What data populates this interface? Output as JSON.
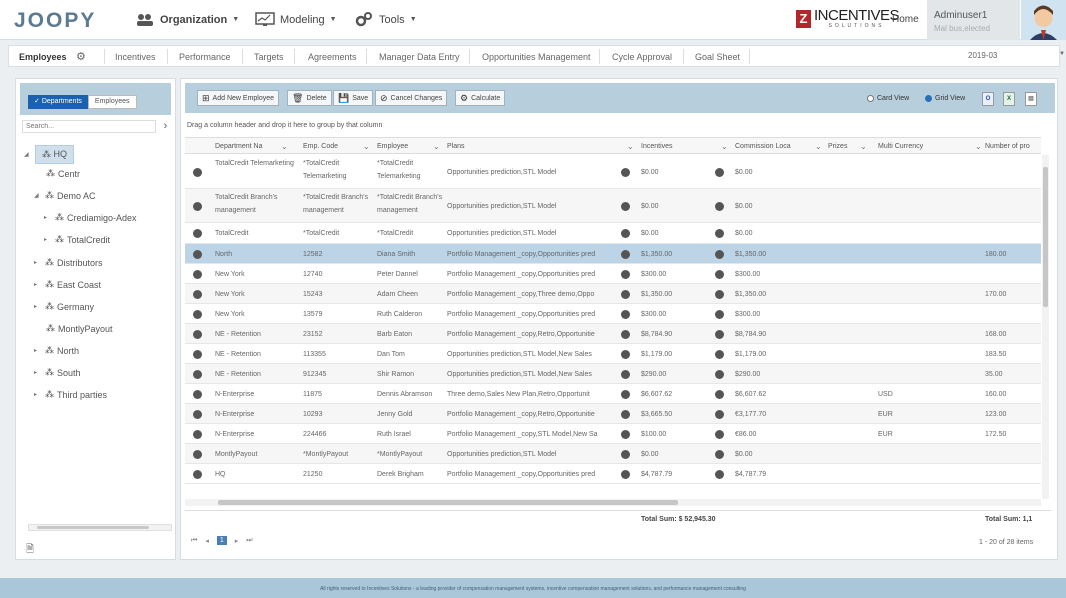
{
  "app": {
    "logo": "JOOPY"
  },
  "nav": {
    "organization": "Organization",
    "modeling": "Modeling",
    "tools": "Tools",
    "brand_main": "INCENTIVES",
    "brand_sub": "SOLUTIONS",
    "home": "Home",
    "user_name": "Adminuser1",
    "user_sub": "Mal bus,elected"
  },
  "tabs": [
    "Employees",
    "Incentives",
    "Performance",
    "Targets",
    "Agreements",
    "Manager Data Entry",
    "Opportunities Management",
    "Cycle Approval",
    "Goal Sheet"
  ],
  "period": "2019-03",
  "left": {
    "toggle_on": "Departments",
    "toggle_off": "Employees",
    "search_placeholder": "Search...",
    "tree": [
      {
        "label": "HQ"
      },
      {
        "label": "Centr"
      },
      {
        "label": "Demo AC"
      },
      {
        "label": "Crediamigo-Adex"
      },
      {
        "label": "TotalCredit"
      },
      {
        "label": "Distributors"
      },
      {
        "label": "East Coast"
      },
      {
        "label": "Germany"
      },
      {
        "label": "MontlyPayout"
      },
      {
        "label": "North"
      },
      {
        "label": "South"
      },
      {
        "label": "Third parties"
      }
    ]
  },
  "toolbar": {
    "add": "Add New Employee",
    "delete": "Delete",
    "save": "Save",
    "cancel": "Cancel Changes",
    "calculate": "Calculate",
    "card_view": "Card View",
    "grid_view": "Grid View"
  },
  "grid": {
    "group_hint": "Drag a column header and drop it here to group by that column",
    "columns": [
      "Department Na",
      "Emp. Code",
      "Employee",
      "Plans",
      "Incentives",
      "Commission Loca",
      "Prizes",
      "Multi Currency",
      "Number of pro"
    ],
    "rows": [
      {
        "dept": "TotalCredit Telemarketing",
        "code": "*TotalCredit Telemarketing",
        "emp": "*TotalCredit Telemarketing",
        "plans": "Opportunities prediction,STL Model",
        "inc": "$0.00",
        "comm": "$0.00",
        "cur": "",
        "num": ""
      },
      {
        "dept": "TotalCredit Branch's management",
        "code": "*TotalCredit Branch's management",
        "emp": "*TotalCredit Branch's management",
        "plans": "Opportunities prediction,STL Model",
        "inc": "$0.00",
        "comm": "$0.00",
        "cur": "",
        "num": ""
      },
      {
        "dept": "TotalCredit",
        "code": "*TotalCredit",
        "emp": "*TotalCredit",
        "plans": "Opportunities prediction,STL Model",
        "inc": "$0.00",
        "comm": "$0.00",
        "cur": "",
        "num": ""
      },
      {
        "dept": "North",
        "code": "12582",
        "emp": "Diana Smith",
        "plans": "Portfolio Management _copy,Opportunities pred",
        "inc": "$1,350.00",
        "comm": "$1,350.00",
        "cur": "",
        "num": "180.00"
      },
      {
        "dept": "New York",
        "code": "12740",
        "emp": "Peter Dannel",
        "plans": "Portfolio Management _copy,Opportunities pred",
        "inc": "$300.00",
        "comm": "$300.00",
        "cur": "",
        "num": ""
      },
      {
        "dept": "New York",
        "code": "15243",
        "emp": "Adam Cheen",
        "plans": "Portfolio Management _copy,Three demo,Oppo",
        "inc": "$1,350.00",
        "comm": "$1,350.00",
        "cur": "",
        "num": "170.00"
      },
      {
        "dept": "New York",
        "code": "13579",
        "emp": "Ruth Calderon",
        "plans": "Portfolio Management _copy,Opportunities pred",
        "inc": "$300.00",
        "comm": "$300.00",
        "cur": "",
        "num": ""
      },
      {
        "dept": "NE - Retention",
        "code": "23152",
        "emp": "Barb Eaton",
        "plans": "Portfolio Management _copy,Retro,Opportunitie",
        "inc": "$8,784.90",
        "comm": "$8,784.90",
        "cur": "",
        "num": "168.00"
      },
      {
        "dept": "NE - Retention",
        "code": "113355",
        "emp": "Dan Tom",
        "plans": "Opportunities prediction,STL Model,New Sales",
        "inc": "$1,179.00",
        "comm": "$1,179.00",
        "cur": "",
        "num": "183.50"
      },
      {
        "dept": "NE - Retention",
        "code": "912345",
        "emp": "Shir Ramon",
        "plans": "Opportunities prediction,STL Model,New Sales",
        "inc": "$290.00",
        "comm": "$290.00",
        "cur": "",
        "num": "35.00"
      },
      {
        "dept": "N-Enterprise",
        "code": "11875",
        "emp": "Dennis Abramson",
        "plans": "Three demo,Sales New Plan,Retro,Opportunit",
        "inc": "$6,607.62",
        "comm": "$6,607.62",
        "cur": "USD",
        "num": "160.00"
      },
      {
        "dept": "N-Enterprise",
        "code": "10293",
        "emp": "Jenny Gold",
        "plans": "Portfolio Management _copy,Retro,Opportunitie",
        "inc": "$3,665.50",
        "comm": "€3,177.70",
        "cur": "EUR",
        "num": "123.00"
      },
      {
        "dept": "N-Enterprise",
        "code": "224466",
        "emp": "Ruth Israel",
        "plans": "Portfolio Management _copy,STL Model,New Sa",
        "inc": "$100.00",
        "comm": "€86.00",
        "cur": "EUR",
        "num": "172.50"
      },
      {
        "dept": "MontlyPayout",
        "code": "*MontlyPayout",
        "emp": "*MontlyPayout",
        "plans": "Opportunities prediction,STL Model",
        "inc": "$0.00",
        "comm": "$0.00",
        "cur": "",
        "num": ""
      },
      {
        "dept": "HQ",
        "code": "21250",
        "emp": "Derek Brigham",
        "plans": "Portfolio Management _copy,Opportunities pred",
        "inc": "$4,787.79",
        "comm": "$4,787.79",
        "cur": "",
        "num": ""
      }
    ],
    "total_sum_label": "Total Sum: $ 52,945.30",
    "total_sum_right": "Total Sum: 1,1",
    "page_current": "1",
    "page_info": "1 - 20 of 28 items"
  },
  "footer": "All rights reserved to Incentives Solutions - a leading provider of compensation management systems, incentive compensation management solutions, and performance management consulting"
}
